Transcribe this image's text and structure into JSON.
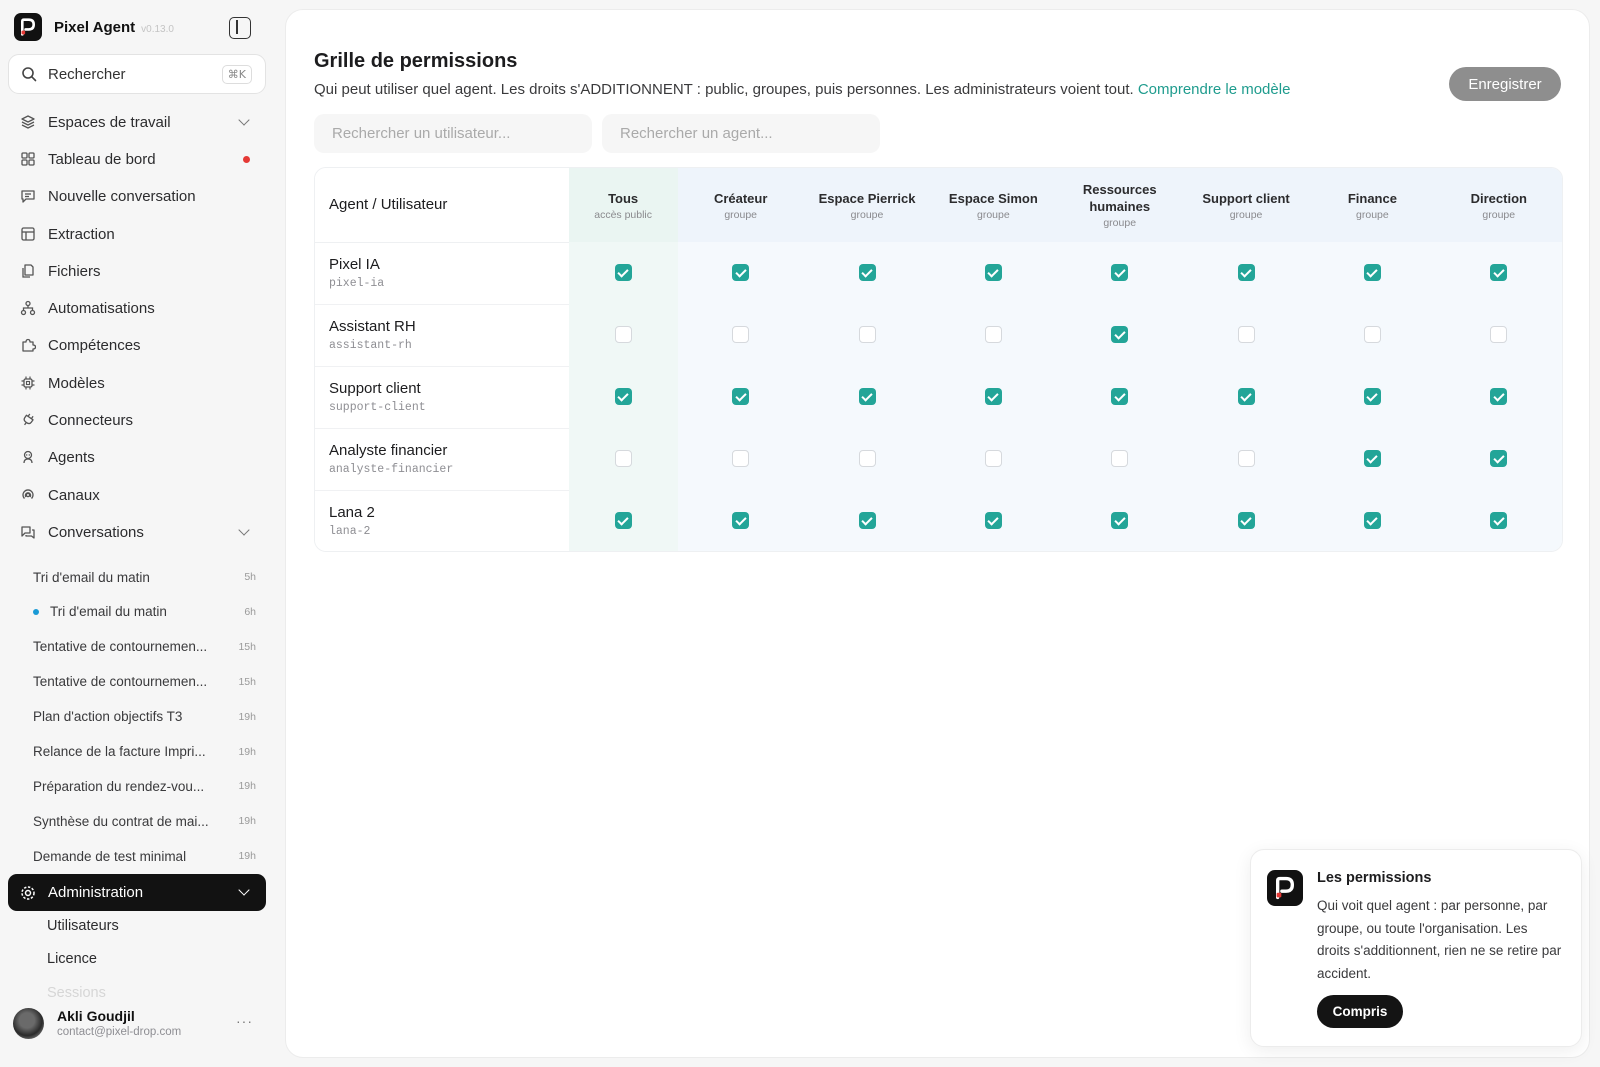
{
  "app": {
    "name": "Pixel Agent",
    "version": "v0.13.0"
  },
  "search": {
    "label": "Rechercher",
    "shortcut": "⌘K"
  },
  "nav": [
    {
      "label": "Espaces de travail",
      "icon": "layers-icon",
      "chevron": true
    },
    {
      "label": "Tableau de bord",
      "icon": "dashboard-icon",
      "badge": "red-dot"
    },
    {
      "label": "Nouvelle conversation",
      "icon": "new-chat-icon"
    },
    {
      "label": "Extraction",
      "icon": "table-icon"
    },
    {
      "label": "Fichiers",
      "icon": "files-icon"
    },
    {
      "label": "Automatisations",
      "icon": "workflow-icon"
    },
    {
      "label": "Compétences",
      "icon": "puzzle-icon"
    },
    {
      "label": "Modèles",
      "icon": "chip-icon"
    },
    {
      "label": "Connecteurs",
      "icon": "plug-icon"
    },
    {
      "label": "Agents",
      "icon": "bot-icon"
    },
    {
      "label": "Canaux",
      "icon": "broadcast-icon"
    },
    {
      "label": "Conversations",
      "icon": "chats-icon",
      "chevron": true
    }
  ],
  "conversations": [
    {
      "title": "Tri d'email du matin",
      "time": "5h",
      "active": false
    },
    {
      "title": "Tri d'email du matin",
      "time": "6h",
      "active": true
    },
    {
      "title": "Tentative de contournemen...",
      "time": "15h",
      "active": false
    },
    {
      "title": "Tentative de contournemen...",
      "time": "15h",
      "active": false
    },
    {
      "title": "Plan d'action objectifs T3",
      "time": "19h",
      "active": false
    },
    {
      "title": "Relance de la facture Impri...",
      "time": "19h",
      "active": false
    },
    {
      "title": "Préparation du rendez-vou...",
      "time": "19h",
      "active": false
    },
    {
      "title": "Synthèse du contrat de mai...",
      "time": "19h",
      "active": false
    },
    {
      "title": "Demande de test minimal",
      "time": "19h",
      "active": false
    }
  ],
  "admin": {
    "label": "Administration",
    "items": [
      "Utilisateurs",
      "Licence",
      "Sessions"
    ]
  },
  "user": {
    "name": "Akli Goudjil",
    "email": "contact@pixel-drop.com",
    "more": "···"
  },
  "page": {
    "title": "Grille de permissions",
    "description": "Qui peut utiliser quel agent. Les droits s'ADDITIONNENT : public, groupes, puis personnes. Les administrateurs voient tout.",
    "link": "Comprendre le modèle",
    "save": "Enregistrer",
    "user_search_placeholder": "Rechercher un utilisateur...",
    "agent_search_placeholder": "Rechercher un agent..."
  },
  "grid": {
    "corner": "Agent / Utilisateur",
    "columns": [
      {
        "name": "Tous",
        "sub": "accès public"
      },
      {
        "name": "Créateur",
        "sub": "groupe"
      },
      {
        "name": "Espace Pierrick",
        "sub": "groupe"
      },
      {
        "name": "Espace Simon",
        "sub": "groupe"
      },
      {
        "name": "Ressources humaines",
        "sub": "groupe"
      },
      {
        "name": "Support client",
        "sub": "groupe"
      },
      {
        "name": "Finance",
        "sub": "groupe"
      },
      {
        "name": "Direction",
        "sub": "groupe"
      }
    ],
    "rows": [
      {
        "name": "Pixel IA",
        "id": "pixel-ia",
        "access": [
          true,
          true,
          true,
          true,
          true,
          true,
          true,
          true
        ]
      },
      {
        "name": "Assistant RH",
        "id": "assistant-rh",
        "access": [
          false,
          false,
          false,
          false,
          true,
          false,
          false,
          false
        ]
      },
      {
        "name": "Support client",
        "id": "support-client",
        "access": [
          true,
          true,
          true,
          true,
          true,
          true,
          true,
          true
        ]
      },
      {
        "name": "Analyste financier",
        "id": "analyste-financier",
        "access": [
          false,
          false,
          false,
          false,
          false,
          false,
          true,
          true
        ]
      },
      {
        "name": "Lana 2",
        "id": "lana-2",
        "access": [
          true,
          true,
          true,
          true,
          true,
          true,
          true,
          true
        ]
      }
    ]
  },
  "toast": {
    "title": "Les permissions",
    "body": "Qui voit quel agent : par personne, par groupe, ou toute l'organisation. Les droits s'additionnent, rien ne se retire par accident.",
    "button": "Compris"
  },
  "colors": {
    "accent": "#23a598",
    "link": "#1f9c8e",
    "dark": "#121212",
    "alert": "#e53935",
    "active_dot": "#1a9ad6"
  }
}
